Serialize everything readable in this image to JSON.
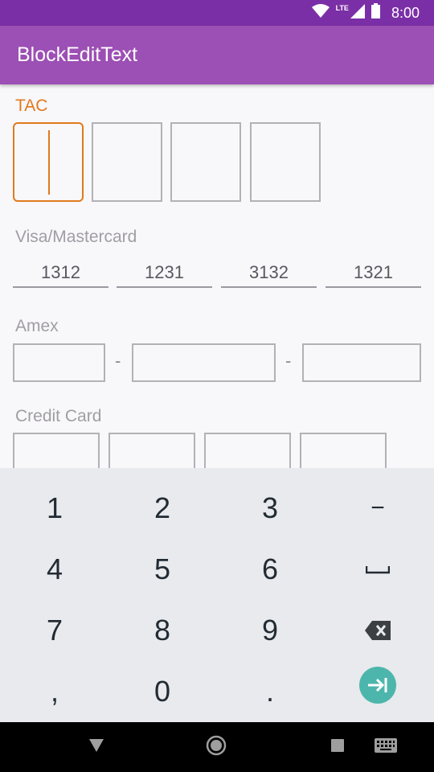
{
  "status_bar": {
    "time": "8:00",
    "network": "LTE"
  },
  "app_bar": {
    "title": "BlockEditText"
  },
  "tac": {
    "label": "TAC",
    "boxes": [
      "",
      "",
      "",
      ""
    ]
  },
  "visa": {
    "label": "Visa/Mastercard",
    "fields": [
      "1312",
      "1231",
      "3132",
      "1321"
    ]
  },
  "amex": {
    "label": "Amex",
    "separator": "-"
  },
  "credit_card": {
    "label": "Credit Card"
  },
  "keyboard": {
    "keys": {
      "k1": "1",
      "k2": "2",
      "k3": "3",
      "minus": "−",
      "k4": "4",
      "k5": "5",
      "k6": "6",
      "k7": "7",
      "k8": "8",
      "k9": "9",
      "comma": ",",
      "k0": "0",
      "period": "."
    }
  },
  "colors": {
    "status_bar": "#7b2fa6",
    "app_bar": "#9c4fb4",
    "accent": "#e07a1d",
    "next_key": "#4db6ac"
  }
}
